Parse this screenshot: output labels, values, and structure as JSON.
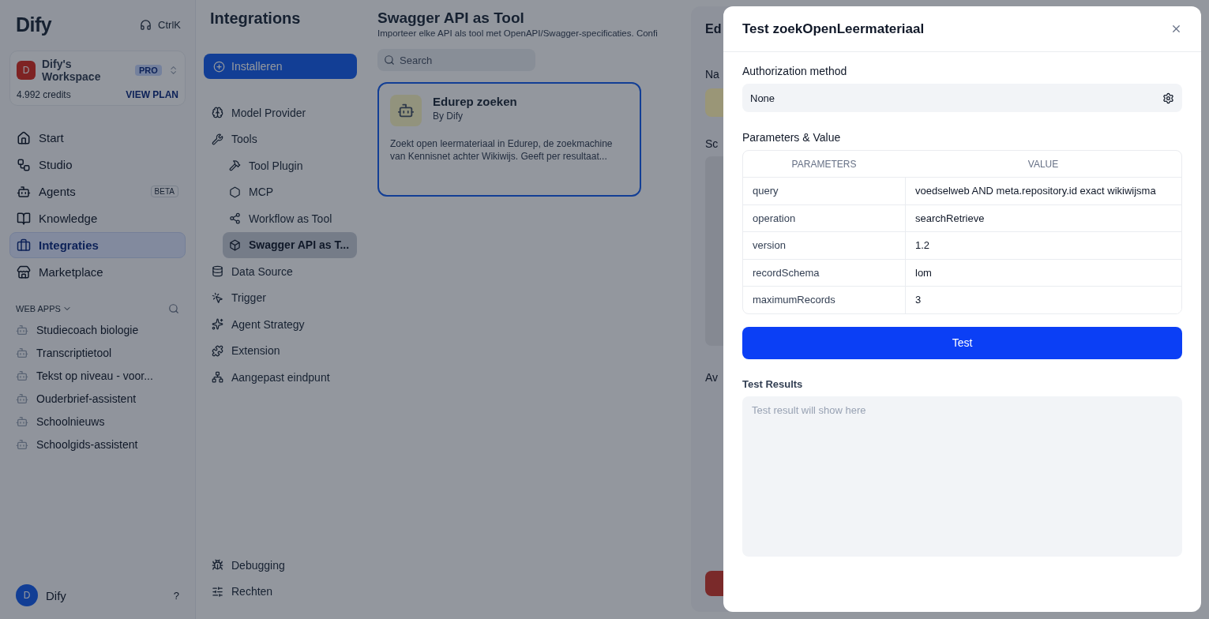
{
  "sidebar": {
    "logo": "Dify",
    "shortcut": "CtrlK",
    "workspace": {
      "avatar": "D",
      "name": "Dify's Workspace",
      "plan": "PRO",
      "credits": "4.992 credits",
      "view_plan": "VIEW PLAN"
    },
    "nav": [
      {
        "label": "Start",
        "selected": false
      },
      {
        "label": "Studio",
        "selected": false
      },
      {
        "label": "Agents",
        "selected": false,
        "badge": "BETA"
      },
      {
        "label": "Knowledge",
        "selected": false
      },
      {
        "label": "Integraties",
        "selected": true
      },
      {
        "label": "Marketplace",
        "selected": false
      }
    ],
    "web_apps": {
      "title": "WEB APPS",
      "items": [
        "Studiecoach biologie",
        "Transcriptietool",
        "Tekst op niveau - voor...",
        "Ouderbrief-assistent",
        "Schoolnieuws",
        "Schoolgids-assistent"
      ]
    },
    "user": {
      "avatar": "D",
      "name": "Dify",
      "help": "?"
    }
  },
  "integrations": {
    "title": "Integrations",
    "install": "Installeren",
    "nav": [
      {
        "label": "Model Provider",
        "selected": false
      },
      {
        "label": "Tools",
        "selected": false,
        "children": [
          {
            "label": "Tool Plugin",
            "selected": false
          },
          {
            "label": "MCP",
            "selected": false
          },
          {
            "label": "Workflow as Tool",
            "selected": false
          },
          {
            "label": "Swagger API as T...",
            "selected": true
          }
        ]
      },
      {
        "label": "Data Source",
        "selected": false
      },
      {
        "label": "Trigger",
        "selected": false
      },
      {
        "label": "Agent Strategy",
        "selected": false
      },
      {
        "label": "Extension",
        "selected": false
      },
      {
        "label": "Aangepast eindpunt",
        "selected": false
      }
    ],
    "bottom": [
      {
        "label": "Debugging",
        "selected": false
      },
      {
        "label": "Rechten",
        "selected": false
      }
    ]
  },
  "main": {
    "title": "Swagger API as Tool",
    "subtitle": "Importeer elke API als tool met OpenAPI/Swagger-specificaties. Confi",
    "search": {
      "placeholder": "Search"
    },
    "cards": [
      {
        "name": "Edurep zoeken",
        "author": "By Dify",
        "description": "Zoekt open leermateriaal in Edurep, de zoekmachine van Kennisnet achter Wikiwijs. Geeft per resultaat...",
        "selected": true
      }
    ]
  },
  "edit_drawer": {
    "title": "Ed",
    "labels": [
      "Na",
      "Sc",
      "Av"
    ]
  },
  "test_dialog": {
    "title": "Test zoekOpenLeermateriaal",
    "auth_label": "Authorization method",
    "auth_value": "None",
    "params_label": "Parameters & Value",
    "columns": [
      "PARAMETERS",
      "VALUE"
    ],
    "rows": [
      {
        "name": "query",
        "value": "voedselweb AND meta.repository.id exact wikiwijsma"
      },
      {
        "name": "operation",
        "value": "searchRetrieve"
      },
      {
        "name": "version",
        "value": "1.2"
      },
      {
        "name": "recordSchema",
        "value": "lom"
      },
      {
        "name": "maximumRecords",
        "value": "3"
      }
    ],
    "test_button": "Test",
    "results_label": "Test Results",
    "results": {
      "placeholder": "Test result will show here"
    }
  }
}
